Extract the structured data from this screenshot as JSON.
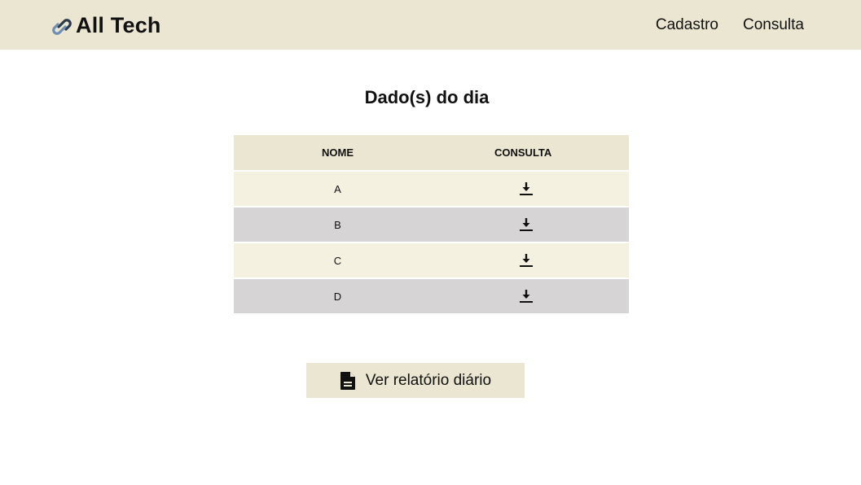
{
  "navbar": {
    "brand": "All Tech",
    "brand_icon": "link-chain-icon",
    "links": [
      {
        "label": "Cadastro"
      },
      {
        "label": "Consulta"
      }
    ],
    "background": "#ebe6d2"
  },
  "main": {
    "title": "Dado(s) do dia",
    "table": {
      "headers": [
        "NOME",
        "CONSULTA"
      ],
      "rows": [
        {
          "nome": "A",
          "consulta_icon": "download-icon"
        },
        {
          "nome": "B",
          "consulta_icon": "download-icon"
        },
        {
          "nome": "C",
          "consulta_icon": "download-icon"
        },
        {
          "nome": "D",
          "consulta_icon": "download-icon"
        }
      ],
      "row_colors": [
        "#f5f1e0",
        "#d6d4d5"
      ]
    },
    "report_button": {
      "label": "Ver relatório diário",
      "icon": "document-icon"
    }
  }
}
